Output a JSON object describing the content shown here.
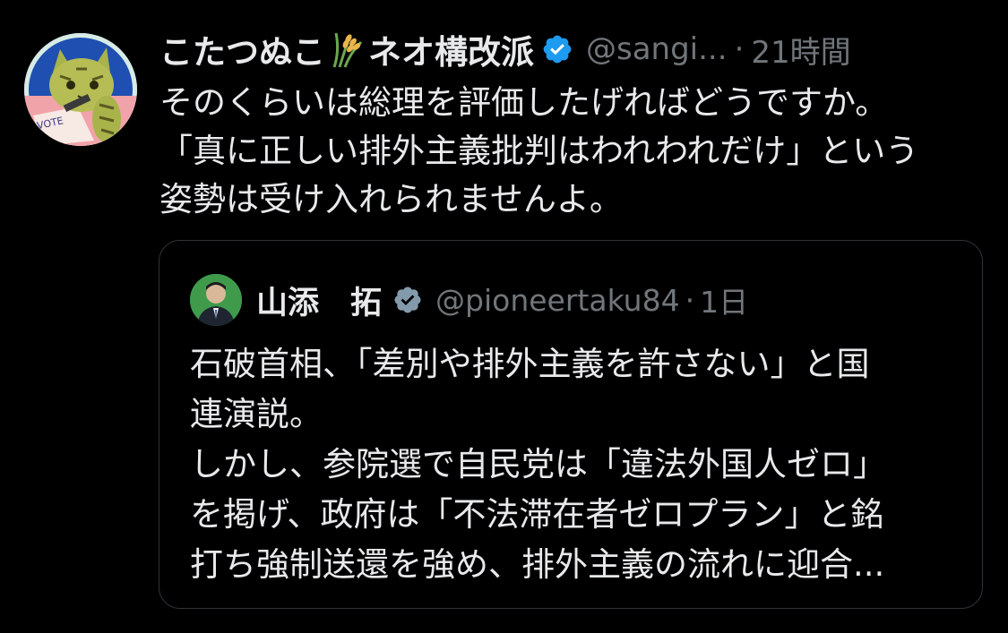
{
  "tweet": {
    "author_name": "こたつぬこ",
    "author_name_suffix": "ネオ構改派",
    "name_emoji": "rice-plant-icon",
    "verified_icon": "verified-badge-icon",
    "handle": "@sangi...",
    "separator": "·",
    "time": "21時間",
    "text": "そのくらいは総理を評価したげればどうですか。\n「真に正しい排外主義批判はわれわれだけ」という\n姿勢は受け入れられませんよ。"
  },
  "quoted_tweet": {
    "author_name": "山添　拓",
    "verified_icon": "verified-badge-icon",
    "handle": "@pioneertaku84",
    "separator": "·",
    "time": "1日",
    "text": "石破首相、「差別や排外主義を許さない」と国\n連演説。\nしかし、参院選で自民党は「違法外国人ゼロ」\nを掲げ、政府は「不法滞在者ゼロプラン」と銘\n打ち強制送還を強め、排外主義の流れに迎合..."
  },
  "colors": {
    "background": "#000000",
    "text": "#e7e9ea",
    "secondary": "#71767b",
    "verified_blue": "#1d9bf0",
    "verified_gray": "#829aab",
    "border": "#2f3336"
  }
}
